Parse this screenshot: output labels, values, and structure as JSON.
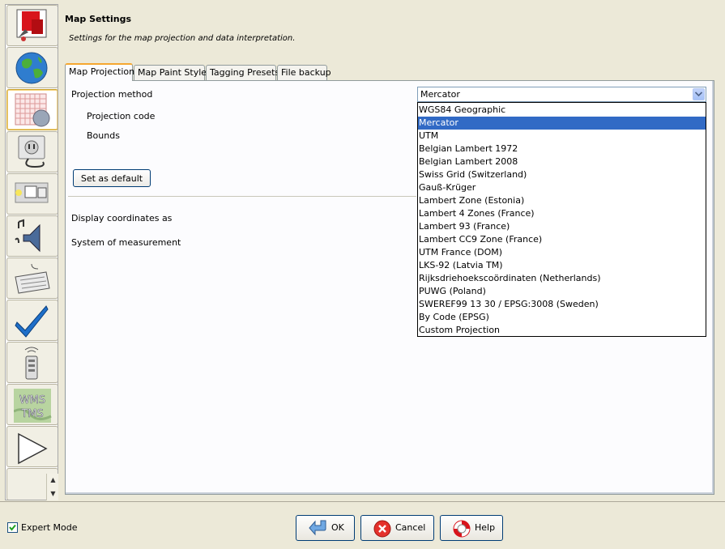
{
  "header": {
    "title": "Map Settings",
    "subtitle": "Settings for the map projection and data interpretation."
  },
  "sidebar": {
    "items": [
      {
        "icon": "paintbrush-icon"
      },
      {
        "icon": "globe-icon"
      },
      {
        "icon": "map-projection-grid-icon",
        "selected": true
      },
      {
        "icon": "plugin-plug-icon"
      },
      {
        "icon": "toolbar-icon"
      },
      {
        "icon": "audio-speaker-icon"
      },
      {
        "icon": "keyboard-icon"
      },
      {
        "icon": "validator-checkmark-icon"
      },
      {
        "icon": "remote-control-icon"
      },
      {
        "icon": "wms-tms-icon",
        "text_line1": "WMS",
        "text_line2": "TMS"
      },
      {
        "icon": "triangle-icon"
      }
    ]
  },
  "tabs": [
    {
      "label": "Map Projection",
      "active": true
    },
    {
      "label": "Map Paint Styles"
    },
    {
      "label": "Tagging Presets"
    },
    {
      "label": "File backup"
    }
  ],
  "projection": {
    "method_label": "Projection method",
    "code_label": "Projection code",
    "bounds_label": "Bounds",
    "set_default_label": "Set as default",
    "selected": "Mercator",
    "options": [
      "WGS84 Geographic",
      "Mercator",
      "UTM",
      "Belgian Lambert 1972",
      "Belgian Lambert 2008",
      "Swiss Grid (Switzerland)",
      "Gauß-Krüger",
      "Lambert Zone (Estonia)",
      "Lambert 4 Zones (France)",
      "Lambert 93 (France)",
      "Lambert CC9 Zone (France)",
      "UTM France (DOM)",
      "LKS-92 (Latvia TM)",
      "Rijksdriehoekscoördinaten (Netherlands)",
      "PUWG (Poland)",
      "SWEREF99 13 30 / EPSG:3008 (Sweden)",
      "By Code (EPSG)",
      "Custom Projection"
    ]
  },
  "display": {
    "coordinates_label": "Display coordinates as",
    "measurement_label": "System of measurement"
  },
  "footer": {
    "expert_mode_label": "Expert Mode",
    "expert_mode_checked": true,
    "ok_label": "OK",
    "cancel_label": "Cancel",
    "help_label": "Help"
  },
  "colors": {
    "selection": "#316ac5",
    "window_bg": "#ece9d8",
    "tab_accent": "#f5a730"
  }
}
